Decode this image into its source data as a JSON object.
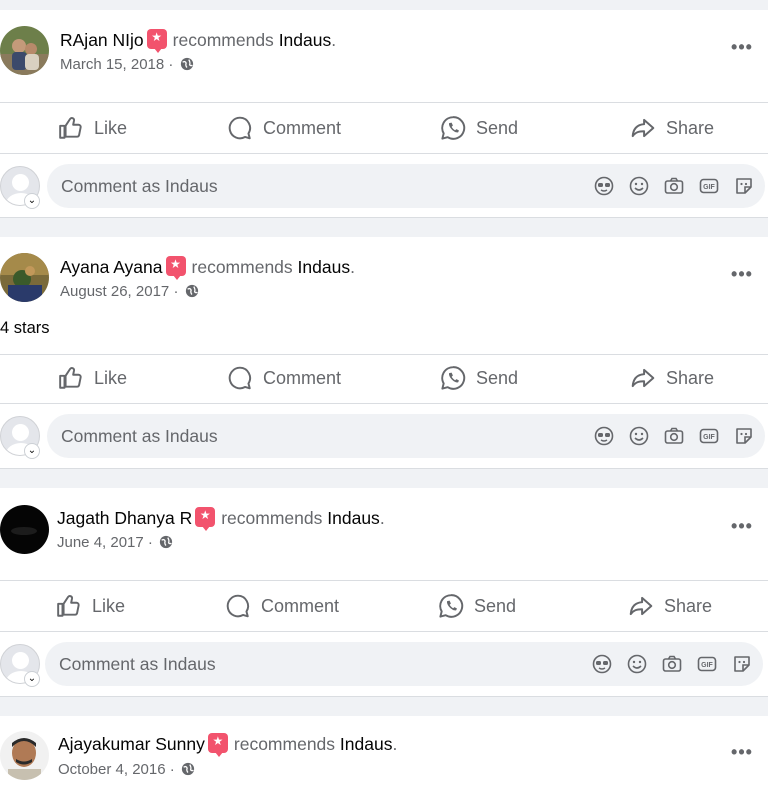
{
  "posts": [
    {
      "author": "RAjan NIjo",
      "action_text": "recommends",
      "page": "Indaus",
      "punct": ".",
      "date": "March 15, 2018",
      "body": ""
    },
    {
      "author": "Ayana Ayana",
      "action_text": "recommends",
      "page": "Indaus",
      "punct": ".",
      "date": "August 26, 2017",
      "body": "4 stars"
    },
    {
      "author": "Jagath Dhanya R",
      "action_text": "recommends",
      "page": "Indaus",
      "punct": ".",
      "date": "June 4, 2017",
      "body": ""
    },
    {
      "author": "Ajayakumar Sunny",
      "action_text": "recommends",
      "page": "Indaus",
      "punct": ".",
      "date": "October 4, 2016",
      "body": ""
    }
  ],
  "actions": {
    "like": "Like",
    "comment": "Comment",
    "send": "Send",
    "share": "Share"
  },
  "comment_box": {
    "placeholder": "Comment as Indaus"
  },
  "meta_separator": "·",
  "more_glyph": "•••",
  "comment_chevron_glyph": "⌄",
  "comment_tools": [
    "avatar-sticker-icon",
    "emoji-icon",
    "camera-icon",
    "gif-icon",
    "sticker-icon"
  ],
  "icons": {
    "globe": "globe-icon",
    "recommend": "recommend-badge-icon",
    "more": "more-options-icon",
    "like": "like-icon",
    "comment": "comment-icon",
    "send": "messenger-send-icon",
    "share": "share-icon"
  },
  "colors": {
    "recommend_badge": "#f2536d",
    "secondary_text": "#65676b",
    "background": "#f0f2f5"
  }
}
